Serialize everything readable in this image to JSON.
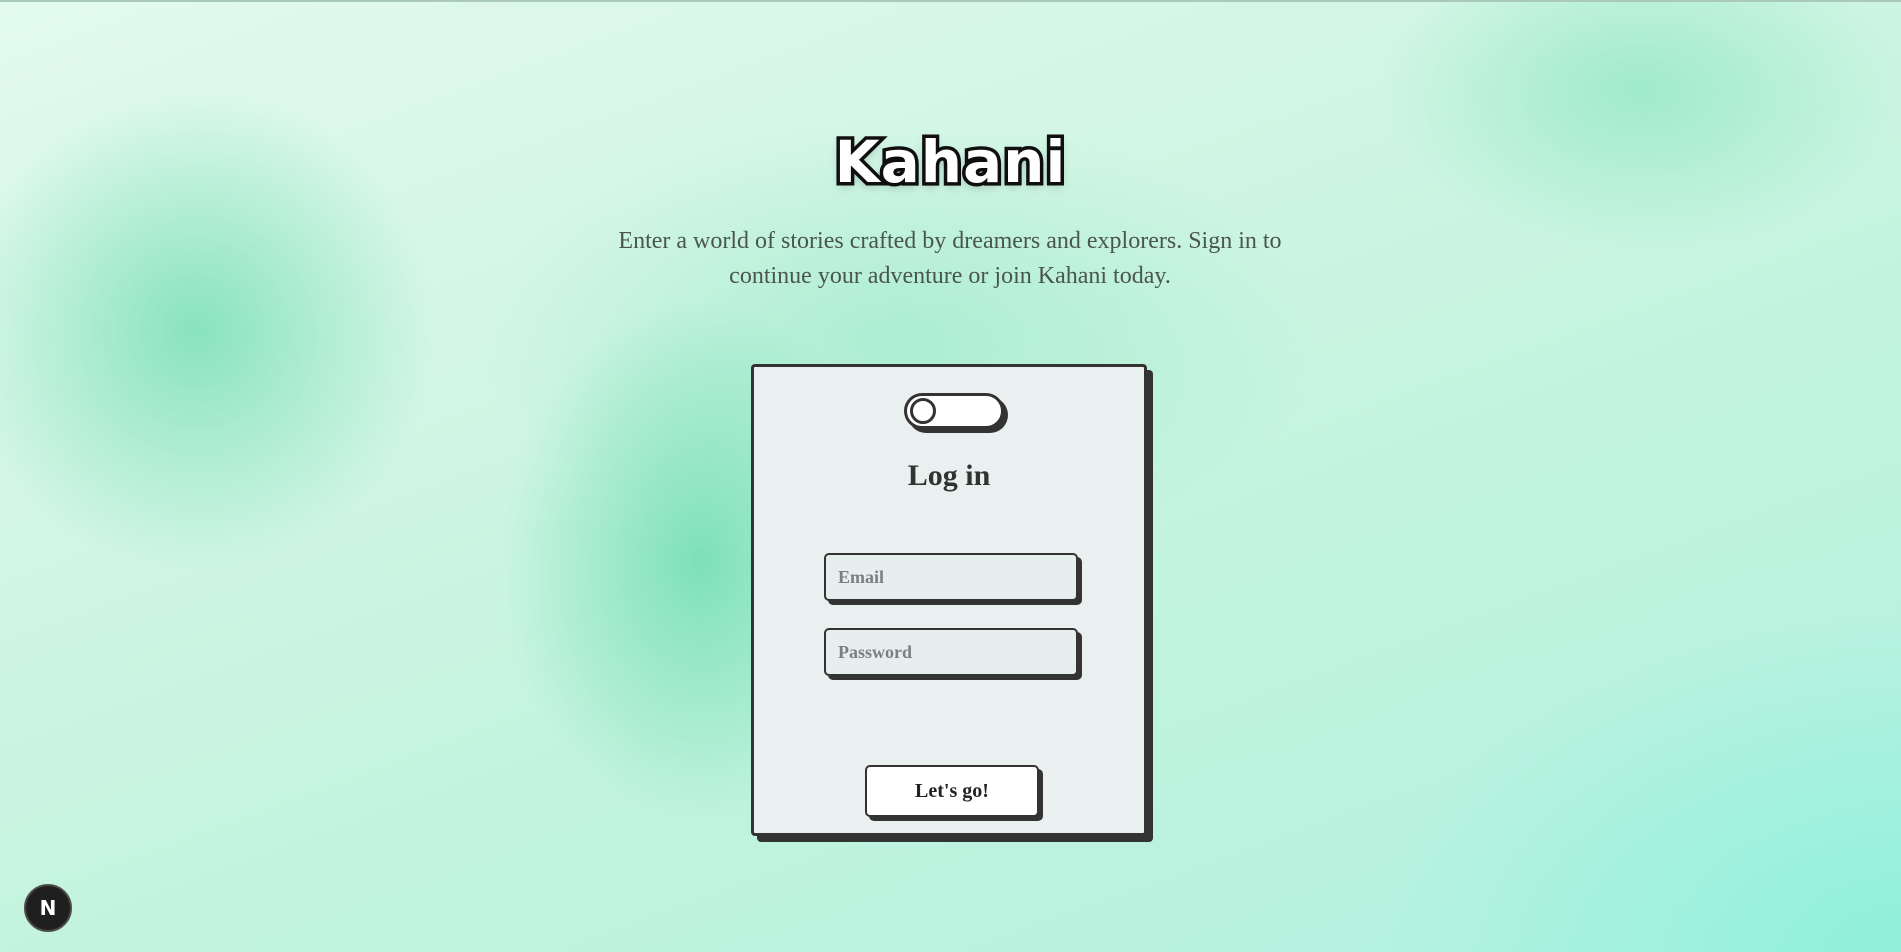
{
  "app": {
    "brand": "Kahani",
    "tagline": "Enter a world of stories crafted by dreamers and explorers. Sign in to continue your adventure or join Kahani today."
  },
  "auth_card": {
    "mode_toggle": {
      "state": "off"
    },
    "title": "Log in",
    "email": {
      "placeholder": "Email",
      "value": ""
    },
    "password": {
      "placeholder": "Password",
      "value": ""
    },
    "submit_label": "Let's go!"
  },
  "dev_badge": {
    "label": "N",
    "icon": "nextjs-logo-icon"
  },
  "colors": {
    "ink": "#333333",
    "card_bg": "#e9f0ef",
    "bg_mint": "#bff5e0",
    "tagline_text": "#4a5552"
  }
}
